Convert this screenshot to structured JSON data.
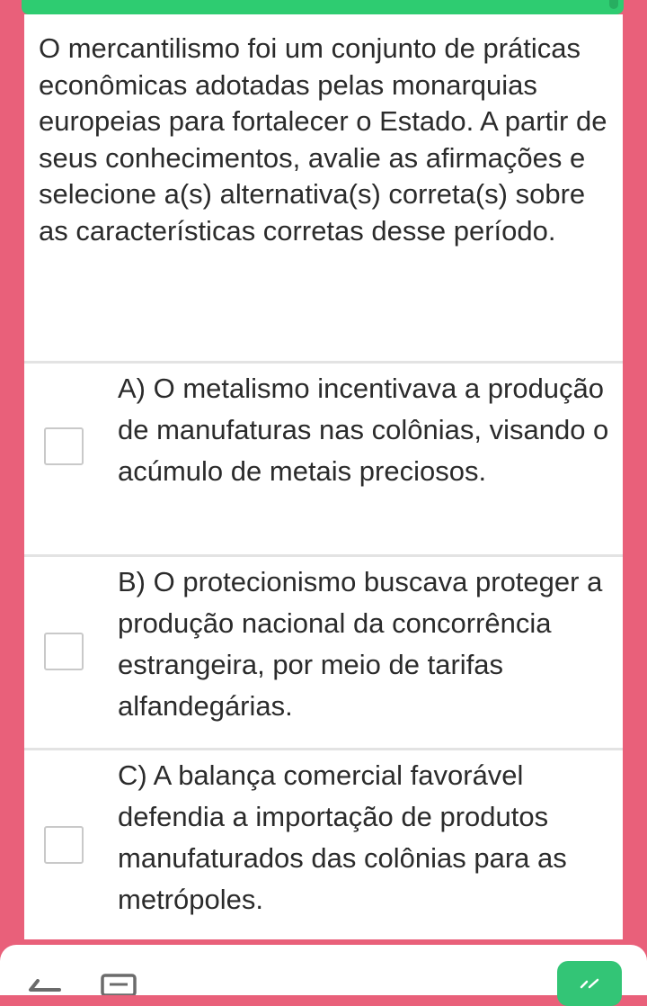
{
  "question": {
    "text": "O mercantilismo foi um conjunto de práticas econômicas adotadas pelas monarquias europeias para fortalecer o Estado. A partir de seus conhecimentos, avalie as afirmações e selecione a(s) alternativa(s) correta(s) sobre as características corretas desse período."
  },
  "options": [
    {
      "text": "A) O metalismo incentivava a produção de manufaturas nas colônias, visando o acúmulo de metais preciosos.",
      "checked": false
    },
    {
      "text": "B) O protecionismo buscava proteger a produção nacional da concorrência estrangeira, por meio de tarifas alfandegárias.",
      "checked": false
    },
    {
      "text": "C) A balança comercial favorável defendia a importação de produtos manufaturados das colônias para as metrópoles.",
      "checked": false
    }
  ],
  "colors": {
    "background": "#e9607a",
    "accent": "#2ecc71",
    "confirm": "#33c576"
  },
  "icons": {
    "back": "arrow-left-icon",
    "list": "question-list-icon",
    "confirm": "check-icon"
  }
}
